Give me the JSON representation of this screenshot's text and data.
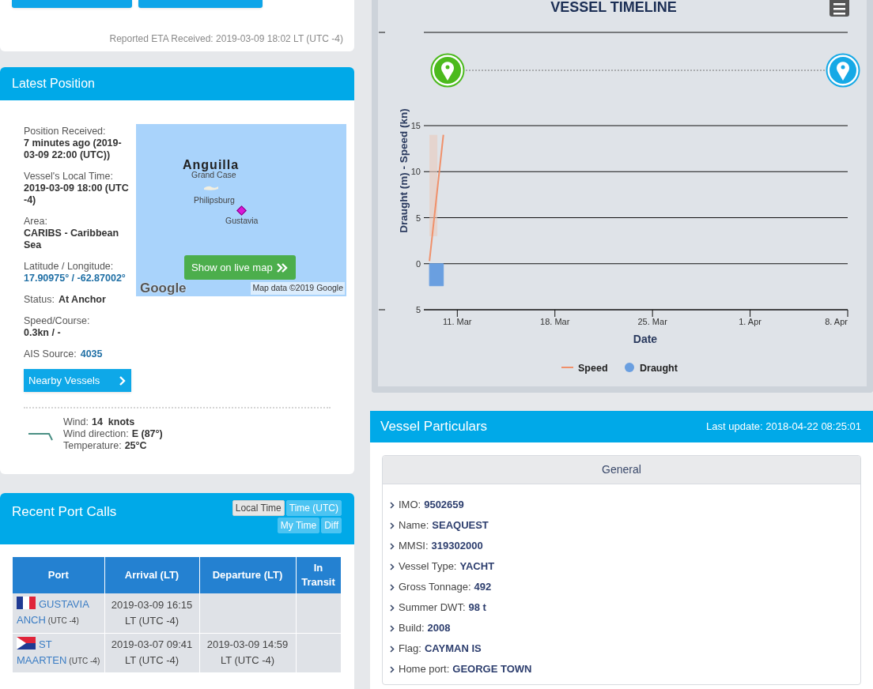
{
  "eta_card": {
    "buttons": [
      {
        "kind": "button"
      },
      {
        "kind": "button"
      }
    ],
    "eta_note": "Reported ETA Received: 2019-03-09 18:02 LT (UTC -4)"
  },
  "latest_position": {
    "title": "Latest Position",
    "fields": [
      {
        "label": "Position Received:",
        "value": "7 minutes ago (2019-03-09 22:00 (UTC))",
        "kind": "stacked",
        "link": false
      },
      {
        "label": "Vessel's Local Time:",
        "value": "2019-03-09 18:00 (UTC -4)",
        "kind": "stacked",
        "link": false
      },
      {
        "label": "Area:",
        "value": "CARIBS - Caribbean Sea",
        "kind": "stacked",
        "link": false
      },
      {
        "label": "Latitude / Longitude:",
        "value": "17.90975° / -62.87002°",
        "kind": "stacked",
        "link": true
      },
      {
        "label": "Status:",
        "value": "At Anchor",
        "kind": "inline",
        "link": false
      },
      {
        "label": "Speed/Course:",
        "value": "0.3kn / -",
        "kind": "stacked",
        "link": false
      },
      {
        "label": "AIS Source:",
        "value": "4035",
        "kind": "inline",
        "link": true
      }
    ],
    "nearby_button": "Nearby Vessels",
    "map": {
      "labels": [
        {
          "text": "Anguilla",
          "kind": "region"
        },
        {
          "text": "Grand Case",
          "kind": "town"
        },
        {
          "text": "Philipsburg",
          "kind": "town"
        },
        {
          "text": "Gustavia",
          "kind": "town"
        }
      ],
      "button": "Show on live map",
      "logo": "Google",
      "attribution": "Map data ©2019 Google"
    },
    "weather": [
      {
        "label": "Wind:",
        "value": "14  knots"
      },
      {
        "label": "Wind direction:",
        "value": "E (87°)"
      },
      {
        "label": "Temperature:",
        "value": "25°C"
      }
    ]
  },
  "recent_port_calls": {
    "title": "Recent Port Calls",
    "time_buttons": [
      {
        "label": "Local Time",
        "selected": true
      },
      {
        "label": "Time (UTC)",
        "selected": false
      },
      {
        "label": "My Time",
        "selected": false
      },
      {
        "label": "Diff",
        "selected": false
      }
    ],
    "columns": [
      "Port",
      "Arrival (LT)",
      "Departure (LT)",
      "In Transit"
    ],
    "rows": [
      {
        "kind": "fr",
        "port": "GUSTAVIA ANCH",
        "utc": "(UTC -4)",
        "arrival": "2019-03-09 16:15 LT (UTC -4)"
      },
      {
        "kind": "sx",
        "port": "ST MAARTEN",
        "utc": "(UTC -4)",
        "arrival": "2019-03-07 09:41 LT (UTC -4)",
        "departure": "2019-03-09 14:59 LT (UTC -4)"
      }
    ]
  },
  "vessel_timeline": {
    "title": "VESSEL TIMELINE",
    "chart_data": {
      "type": "line",
      "xlabel": "Date",
      "ylabel": "Draught (m) - Speed (kn)",
      "categories": [
        null,
        null,
        "11. Mar",
        null,
        null,
        null,
        null,
        null,
        null,
        "18. Mar",
        null,
        null,
        null,
        null,
        null,
        null,
        "25. Mar",
        null,
        null,
        null,
        null,
        null,
        null,
        "1. Apr",
        null,
        null,
        null,
        null,
        null,
        null,
        "8. Apr"
      ],
      "series": [
        {
          "name": "Speed",
          "color": "#f0906a",
          "values": [
            0.3,
            14,
            null,
            null,
            null,
            null,
            null,
            null,
            null,
            null,
            null,
            null,
            null,
            null,
            null,
            null,
            null,
            null,
            null,
            null,
            null,
            null,
            null,
            null,
            null,
            null,
            null,
            null,
            null,
            null,
            null
          ]
        },
        {
          "name": "Draught",
          "type": "area",
          "color": "#6a9fe0",
          "values": [
            -2.4,
            -2.4,
            null,
            null,
            null,
            null,
            null,
            null,
            null,
            null,
            null,
            null,
            null,
            null,
            null,
            null,
            null,
            null,
            null,
            null,
            null,
            null,
            null,
            null,
            null,
            null,
            null,
            null,
            null,
            null,
            null
          ]
        }
      ],
      "ylim": [
        -5,
        15
      ],
      "grid": true,
      "legend": "bottom",
      "yticks": [
        {
          "value": -5,
          "label": "5"
        },
        {
          "value": 0,
          "label": "0"
        },
        {
          "value": 5,
          "label": "5"
        },
        {
          "value": 10,
          "label": "10"
        },
        {
          "value": 15,
          "label": "15"
        }
      ]
    }
  },
  "vessel_particulars": {
    "title": "Vessel Particulars",
    "last_update": "Last update: 2018-04-22 08:25:01",
    "section": "General",
    "items": [
      {
        "label": "IMO:",
        "value": "9502659"
      },
      {
        "label": "Name:",
        "value": "SEAQUEST"
      },
      {
        "label": "MMSI:",
        "value": "319302000"
      },
      {
        "label": "Vessel Type:",
        "value": "YACHT"
      },
      {
        "label": "Gross Tonnage:",
        "value": "492"
      },
      {
        "label": "Summer DWT:",
        "value": "98 t"
      },
      {
        "label": "Build:",
        "value": "2008"
      },
      {
        "label": "Flag:",
        "value": "CAYMAN IS"
      },
      {
        "label": "Home port:",
        "value": "GEORGE TOWN"
      }
    ]
  }
}
